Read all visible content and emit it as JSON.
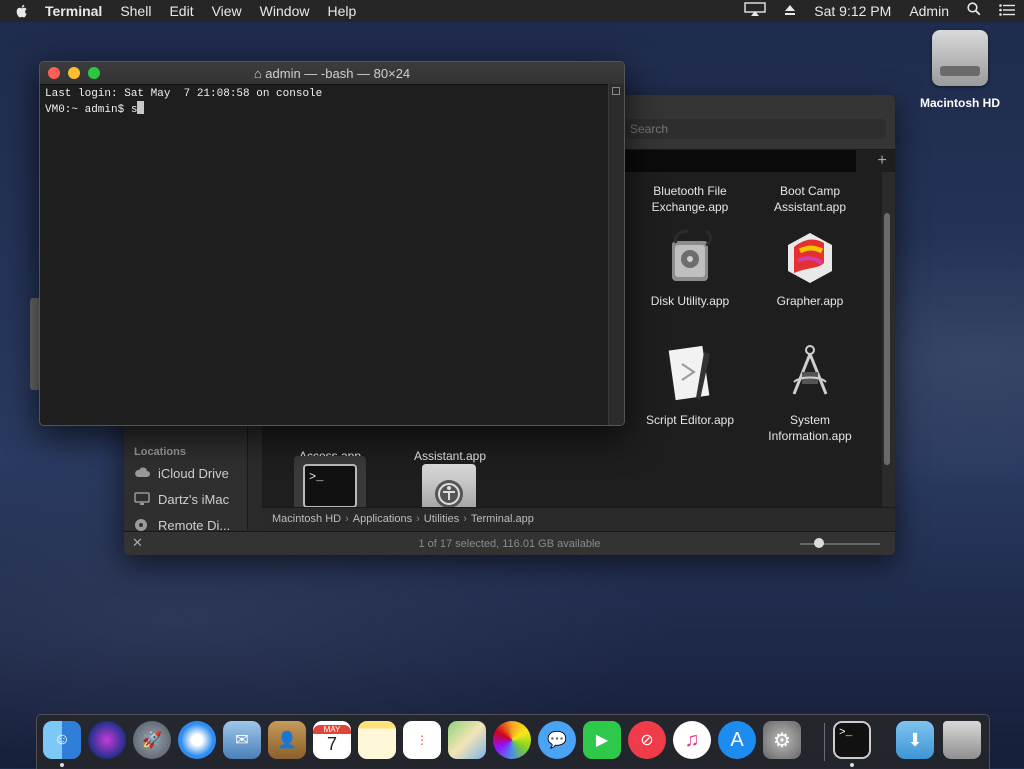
{
  "menubar": {
    "app_name": "Terminal",
    "items": [
      "Shell",
      "Edit",
      "View",
      "Window",
      "Help"
    ],
    "clock": "Sat 9:12 PM",
    "user": "Admin"
  },
  "desktop": {
    "hd_label": "Macintosh HD"
  },
  "finder": {
    "search_placeholder": "Search",
    "sidebar_section": "Locations",
    "sidebar_items": [
      "iCloud Drive",
      "Dartz's iMac",
      "Remote Di..."
    ],
    "items": [
      {
        "label": "Bluetooth File Exchange.app"
      },
      {
        "label": "Boot Camp Assistant.app"
      },
      {
        "label": "Disk Utility.app"
      },
      {
        "label": "Grapher.app"
      },
      {
        "label": "Script Editor.app"
      },
      {
        "label": "System Information.app"
      },
      {
        "label": "Access.app"
      },
      {
        "label": "Assistant.app"
      }
    ],
    "path": [
      "Macintosh HD",
      "Applications",
      "Utilities",
      "Terminal.app"
    ],
    "status": "1 of 17 selected, 116.01 GB available"
  },
  "terminal": {
    "title": "admin — -bash — 80×24",
    "lines": [
      "Last login: Sat May  7 21:08:58 on console"
    ],
    "prompt": "VM0:~ admin$ s"
  },
  "dock": {
    "items": [
      "Finder",
      "Siri",
      "Launchpad",
      "Safari",
      "Mail",
      "Contacts",
      "Calendar",
      "Notes",
      "Reminders",
      "Maps",
      "Photos",
      "Messages",
      "FaceTime",
      "News",
      "iTunes",
      "App Store",
      "System Preferences",
      "Terminal",
      "Downloads",
      "Trash"
    ],
    "calendar_month": "MAY",
    "calendar_day": "7"
  },
  "colors": {
    "close": "#fe5f57",
    "minimize": "#febc2e",
    "zoom": "#28c840",
    "menubar": "#262626"
  }
}
